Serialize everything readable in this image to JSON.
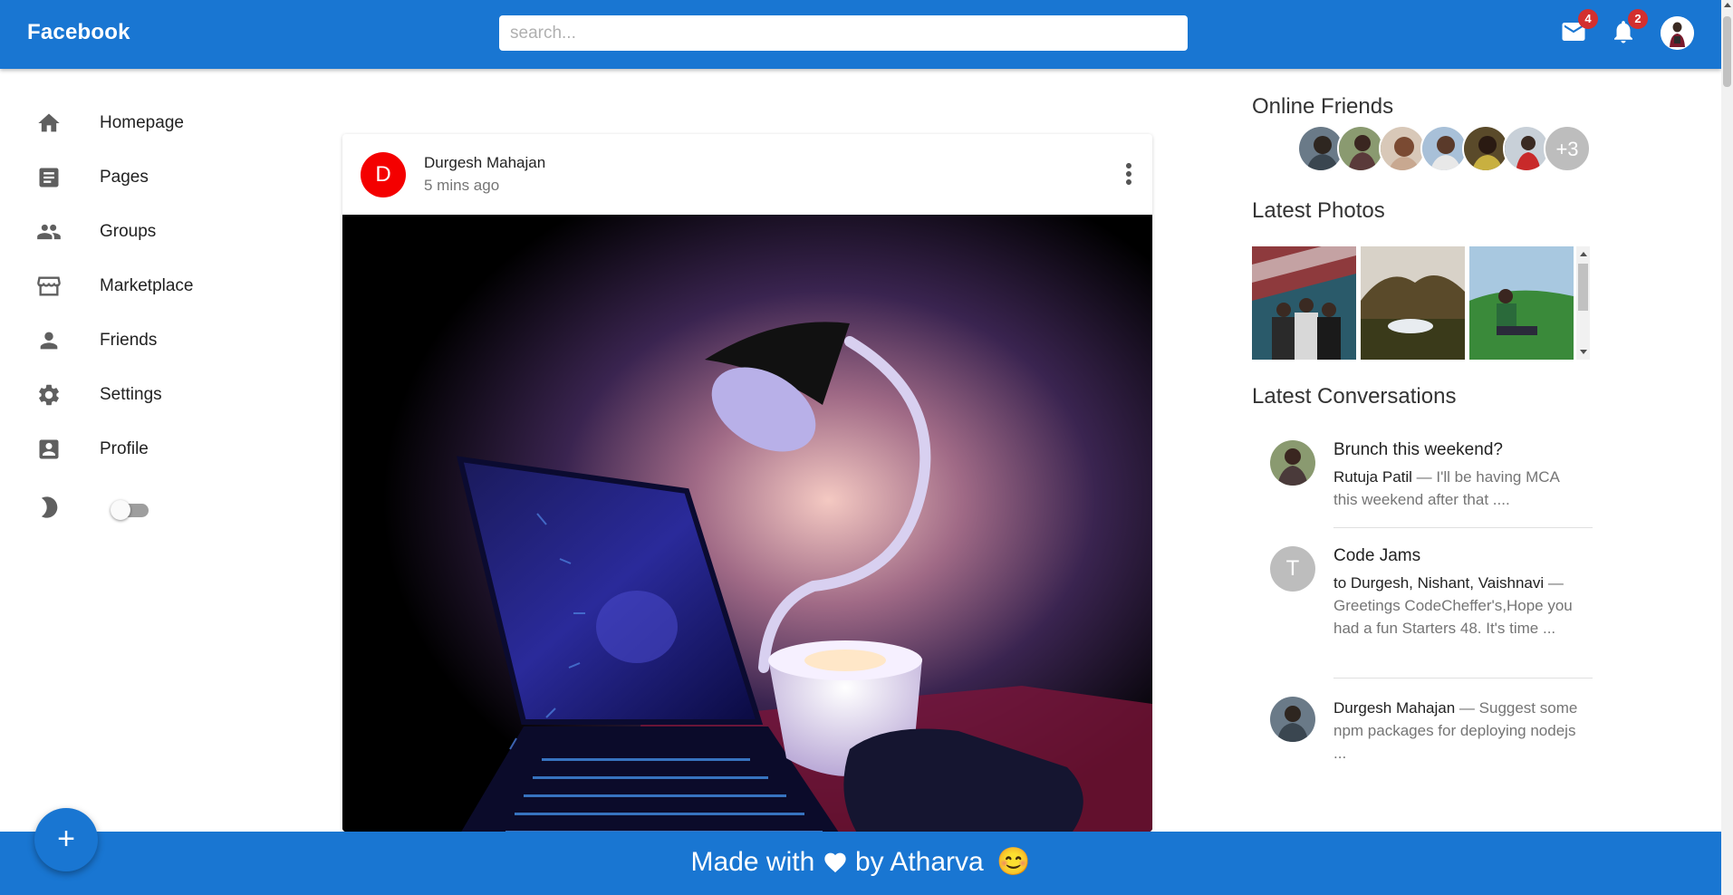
{
  "app": {
    "brand": "Facebook",
    "accent_color": "#1976d2"
  },
  "header": {
    "search_placeholder": "search...",
    "mail_icon": "mail-icon",
    "mail_badge": "4",
    "notification_icon": "bell-icon",
    "notification_badge": "2",
    "badge_color": "#d32f2f"
  },
  "sidebar": {
    "items": [
      {
        "label": "Homepage",
        "icon": "home-icon"
      },
      {
        "label": "Pages",
        "icon": "article-icon"
      },
      {
        "label": "Groups",
        "icon": "group-icon"
      },
      {
        "label": "Marketplace",
        "icon": "storefront-icon"
      },
      {
        "label": "Friends",
        "icon": "person-icon"
      },
      {
        "label": "Settings",
        "icon": "gear-icon"
      },
      {
        "label": "Profile",
        "icon": "account-box-icon"
      }
    ],
    "theme_toggle_icon": "moon-icon",
    "dark_mode_enabled": false
  },
  "post": {
    "avatar_letter": "D",
    "avatar_color": "#f40000",
    "author": "Durgesh Mahajan",
    "time": "5 mins ago",
    "image_description": "laptop-and-desk-lamp-photo"
  },
  "right": {
    "online_friends_title": "Online Friends",
    "online_friends_extra": "+3",
    "latest_photos_title": "Latest Photos",
    "latest_conversations_title": "Latest Conversations",
    "conversations": [
      {
        "title": "Brunch this weekend?",
        "sender": "Rutuja Patil",
        "text": " — I'll be having MCA this weekend after that ...."
      },
      {
        "title": "Code Jams",
        "avatar_letter": "T",
        "sender": "to Durgesh, Nishant, Vaishnavi",
        "text": " — Greetings CodeCheffer's,Hope you had a fun Starters 48. It's time ..."
      },
      {
        "title": "",
        "sender": "Durgesh Mahajan",
        "text": " — Suggest some npm packages for deploying nodejs ..."
      }
    ]
  },
  "footer": {
    "text_before": "Made with",
    "text_after": "by Atharva",
    "heart_icon": "heart-icon",
    "emoji": "😊"
  },
  "fab": {
    "label": "+"
  }
}
